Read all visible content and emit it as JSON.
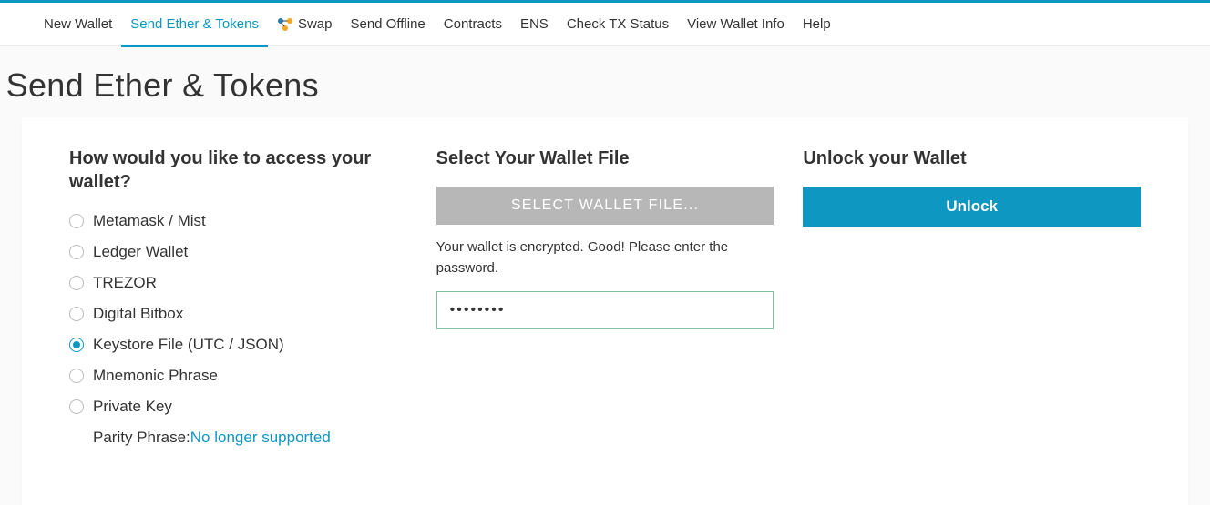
{
  "nav": {
    "items": [
      {
        "label": "New Wallet",
        "active": false,
        "icon": null
      },
      {
        "label": "Send Ether & Tokens",
        "active": true,
        "icon": null
      },
      {
        "label": "Swap",
        "active": false,
        "icon": "swap"
      },
      {
        "label": "Send Offline",
        "active": false,
        "icon": null
      },
      {
        "label": "Contracts",
        "active": false,
        "icon": null
      },
      {
        "label": "ENS",
        "active": false,
        "icon": null
      },
      {
        "label": "Check TX Status",
        "active": false,
        "icon": null
      },
      {
        "label": "View Wallet Info",
        "active": false,
        "icon": null
      },
      {
        "label": "Help",
        "active": false,
        "icon": null
      }
    ]
  },
  "page": {
    "dash": "-",
    "title": "Send Ether & Tokens"
  },
  "access": {
    "heading": "How would you like to access your wallet?",
    "options": [
      {
        "label": "Metamask / Mist",
        "selected": false
      },
      {
        "label": "Ledger Wallet",
        "selected": false
      },
      {
        "label": "TREZOR",
        "selected": false
      },
      {
        "label": "Digital Bitbox",
        "selected": false
      },
      {
        "label": "Keystore File (UTC / JSON)",
        "selected": true
      },
      {
        "label": "Mnemonic Phrase",
        "selected": false
      },
      {
        "label": "Private Key",
        "selected": false
      }
    ],
    "parity_label": "Parity Phrase: ",
    "parity_link": "No longer supported"
  },
  "select_file": {
    "heading": "Select Your Wallet File",
    "button": "SELECT WALLET FILE...",
    "helper": "Your wallet is encrypted. Good! Please enter the password.",
    "password_value": "••••••••"
  },
  "unlock": {
    "heading": "Unlock your Wallet",
    "button": "Unlock"
  }
}
